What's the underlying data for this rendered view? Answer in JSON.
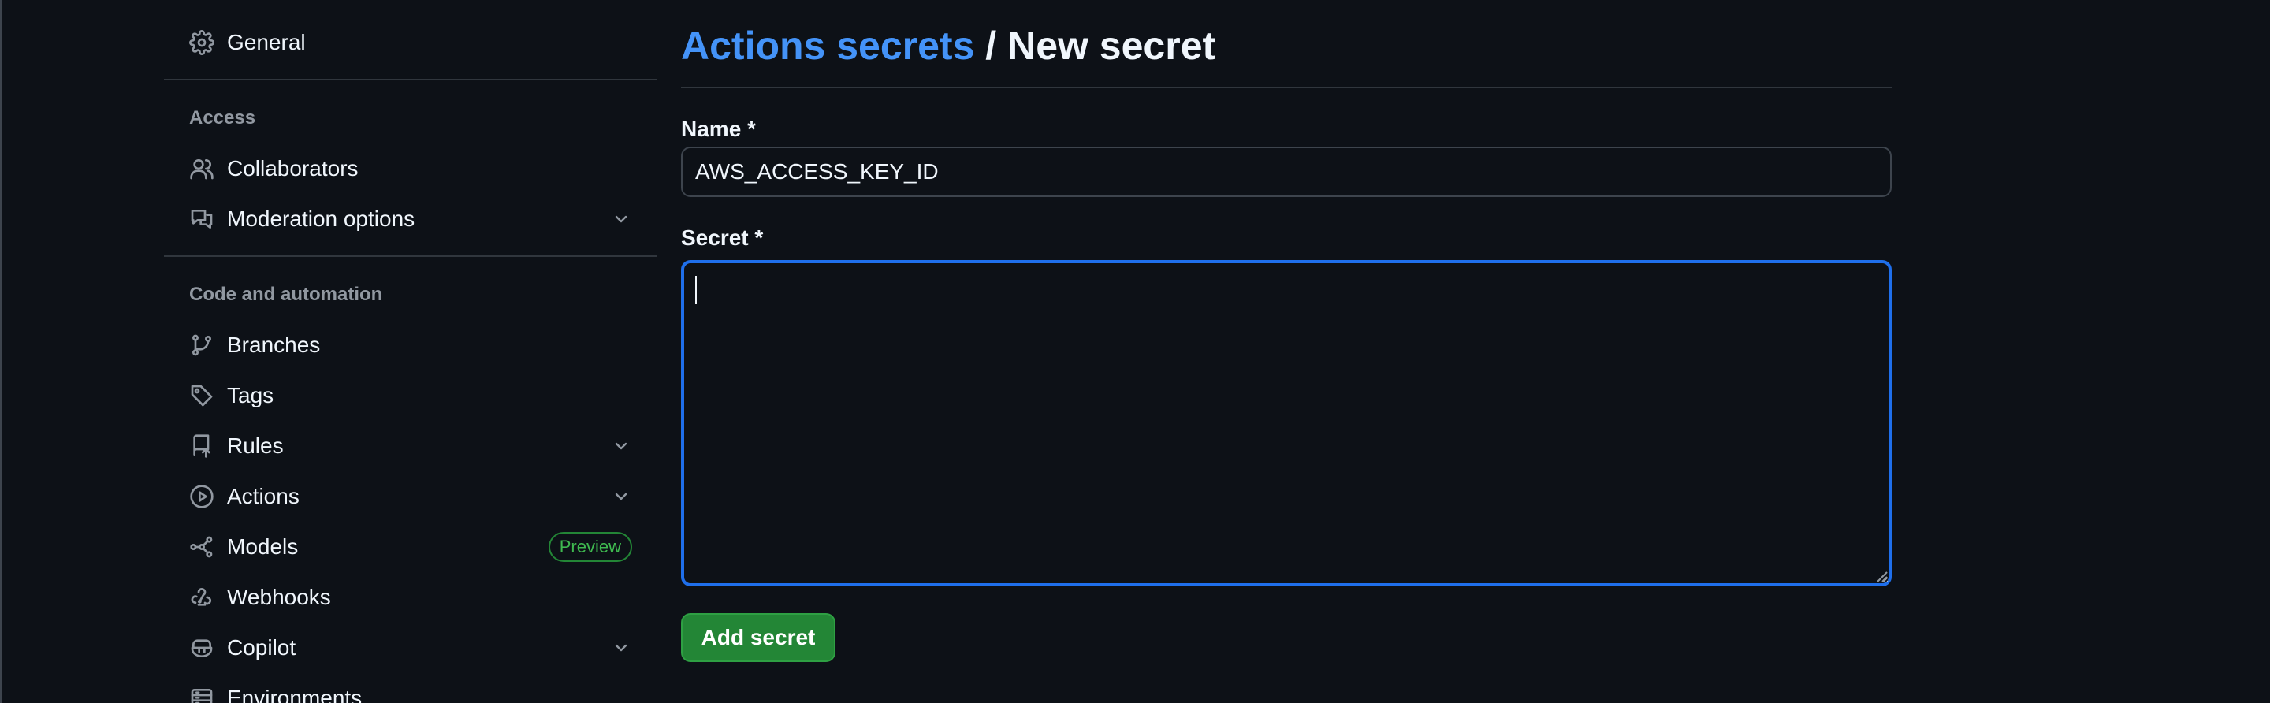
{
  "sidebar": {
    "general_label": "General",
    "sections": {
      "access": "Access",
      "code_automation": "Code and automation"
    },
    "items": {
      "collaborators": "Collaborators",
      "moderation": "Moderation options",
      "branches": "Branches",
      "tags": "Tags",
      "rules": "Rules",
      "actions": "Actions",
      "models": "Models",
      "models_badge": "Preview",
      "webhooks": "Webhooks",
      "copilot": "Copilot",
      "environments": "Environments"
    },
    "icons": {
      "general": "gear-icon",
      "collaborators": "people-icon",
      "moderation": "comment-discussion-icon",
      "branches": "git-branch-icon",
      "tags": "tag-icon",
      "rules": "repo-push-icon",
      "actions": "play-icon",
      "models": "model-icon",
      "webhooks": "webhook-icon",
      "copilot": "copilot-icon",
      "environments": "server-icon",
      "expand": "chevron-down-icon"
    }
  },
  "main": {
    "breadcrumb_link": "Actions secrets",
    "breadcrumb_separator": "/",
    "title": "New secret",
    "name_label": "Name *",
    "name_value": "AWS_ACCESS_KEY_ID",
    "secret_label": "Secret *",
    "secret_value": "",
    "submit_label": "Add secret"
  },
  "colors": {
    "background": "#0d1117",
    "link": "#4493f8",
    "focus_border": "#1f6feb",
    "primary_button": "#238636",
    "badge_green": "#3fb950"
  }
}
